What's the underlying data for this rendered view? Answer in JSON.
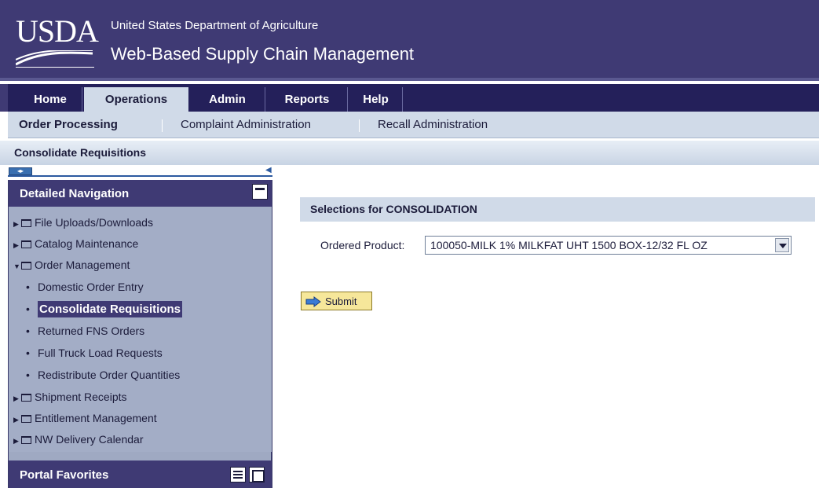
{
  "header": {
    "logo": "USDA",
    "department": "United States Department of Agriculture",
    "app_title": "Web-Based Supply Chain Management"
  },
  "top_nav": {
    "tabs": [
      {
        "label": "Home",
        "active": false
      },
      {
        "label": "Operations",
        "active": true
      },
      {
        "label": "Admin",
        "active": false
      },
      {
        "label": "Reports",
        "active": false
      },
      {
        "label": "Help",
        "active": false
      }
    ]
  },
  "sub_nav": {
    "items": [
      {
        "label": "Order Processing",
        "active": true
      },
      {
        "label": "Complaint Administration",
        "active": false
      },
      {
        "label": "Recall Administration",
        "active": false
      }
    ]
  },
  "page": {
    "title": "Consolidate Requisitions"
  },
  "left_nav": {
    "title": "Detailed Navigation",
    "folders": [
      {
        "label": "File Uploads/Downloads",
        "expanded": false
      },
      {
        "label": "Catalog Maintenance",
        "expanded": false
      },
      {
        "label": "Order Management",
        "expanded": true
      }
    ],
    "children": [
      {
        "label": "Domestic Order Entry",
        "selected": false
      },
      {
        "label": "Consolidate Requisitions",
        "selected": true
      },
      {
        "label": "Returned FNS Orders",
        "selected": false
      },
      {
        "label": "Full Truck Load Requests",
        "selected": false
      },
      {
        "label": "Redistribute Order Quantities",
        "selected": false
      }
    ],
    "folders_after": [
      {
        "label": "Shipment Receipts",
        "expanded": false
      },
      {
        "label": "Entitlement Management",
        "expanded": false
      },
      {
        "label": "NW Delivery Calendar",
        "expanded": false
      }
    ],
    "portal_favorites": "Portal Favorites"
  },
  "content": {
    "section_title": "Selections for CONSOLIDATION",
    "ordered_product_label": "Ordered Product:",
    "ordered_product_value": "100050-MILK 1% MILKFAT UHT 1500 BOX-12/32 FL OZ",
    "submit_label": "Submit"
  },
  "colors": {
    "header_bg": "#3f3a74",
    "nav_dark": "#24205a",
    "light_blue": "#d0dae8",
    "leftnav_bg": "#a3adc6",
    "submit_bg": "#f6e79a"
  }
}
